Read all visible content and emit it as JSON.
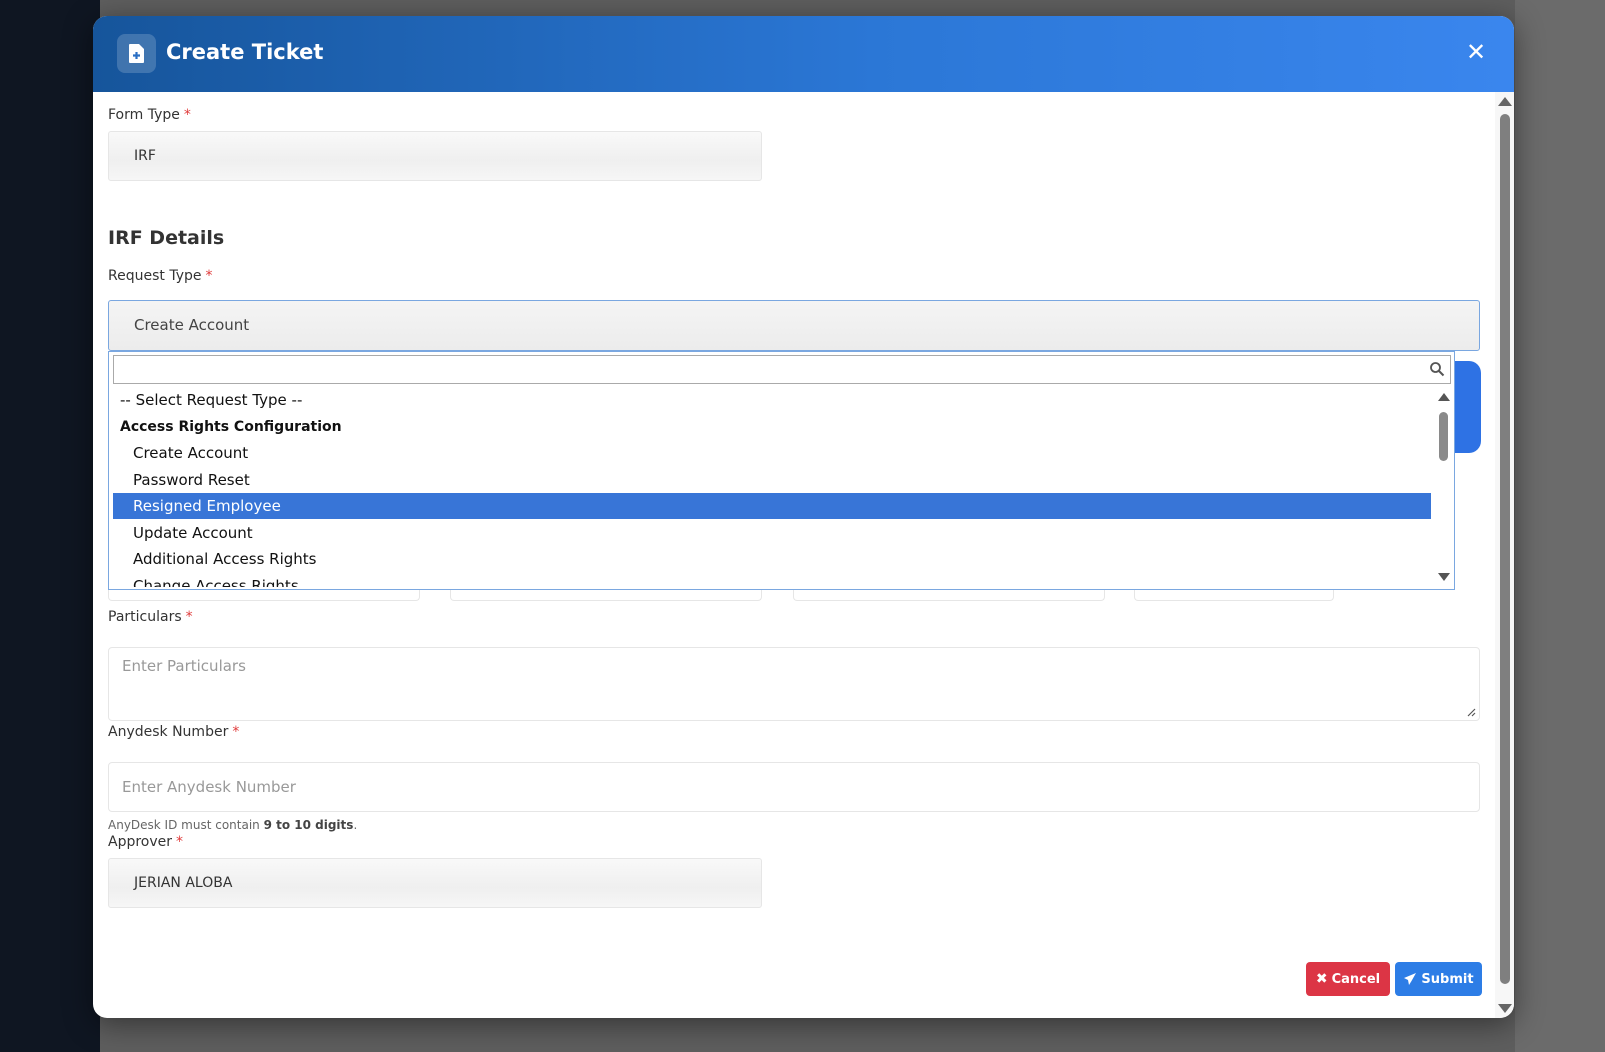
{
  "modal": {
    "title": "Create Ticket",
    "close": "✕"
  },
  "form_type": {
    "label": "Form Type",
    "required": "*",
    "value": "IRF"
  },
  "section": {
    "title": "IRF Details"
  },
  "request_type": {
    "label": "Request Type",
    "required": "*",
    "value": "Create Account",
    "search_placeholder": "",
    "options": [
      {
        "label": "-- Select Request Type --",
        "kind": "placeholder"
      },
      {
        "label": "Access Rights Configuration",
        "kind": "group"
      },
      {
        "label": "Create Account",
        "kind": "option"
      },
      {
        "label": "Password Reset",
        "kind": "option"
      },
      {
        "label": "Resigned Employee",
        "kind": "option",
        "highlighted": true
      },
      {
        "label": "Update Account",
        "kind": "option"
      },
      {
        "label": "Additional Access Rights",
        "kind": "option"
      },
      {
        "label": "Change Access Rights",
        "kind": "option"
      }
    ]
  },
  "particulars": {
    "label": "Particulars",
    "required": "*",
    "placeholder": "Enter Particulars"
  },
  "anydesk": {
    "label": "Anydesk Number",
    "required": "*",
    "placeholder": "Enter Anydesk Number",
    "helper_prefix": "AnyDesk ID must contain ",
    "helper_bold": "9 to 10 digits",
    "helper_suffix": "."
  },
  "approver": {
    "label": "Approver",
    "required": "*",
    "value": "JERIAN ALOBA"
  },
  "buttons": {
    "cancel": "Cancel",
    "submit": "Submit"
  },
  "colors": {
    "header_start": "#16559b",
    "header_end": "#3a86ee",
    "highlight": "#3875d7",
    "cancel": "#dc3545",
    "submit": "#2d7de6",
    "required": "#e03a3a"
  }
}
